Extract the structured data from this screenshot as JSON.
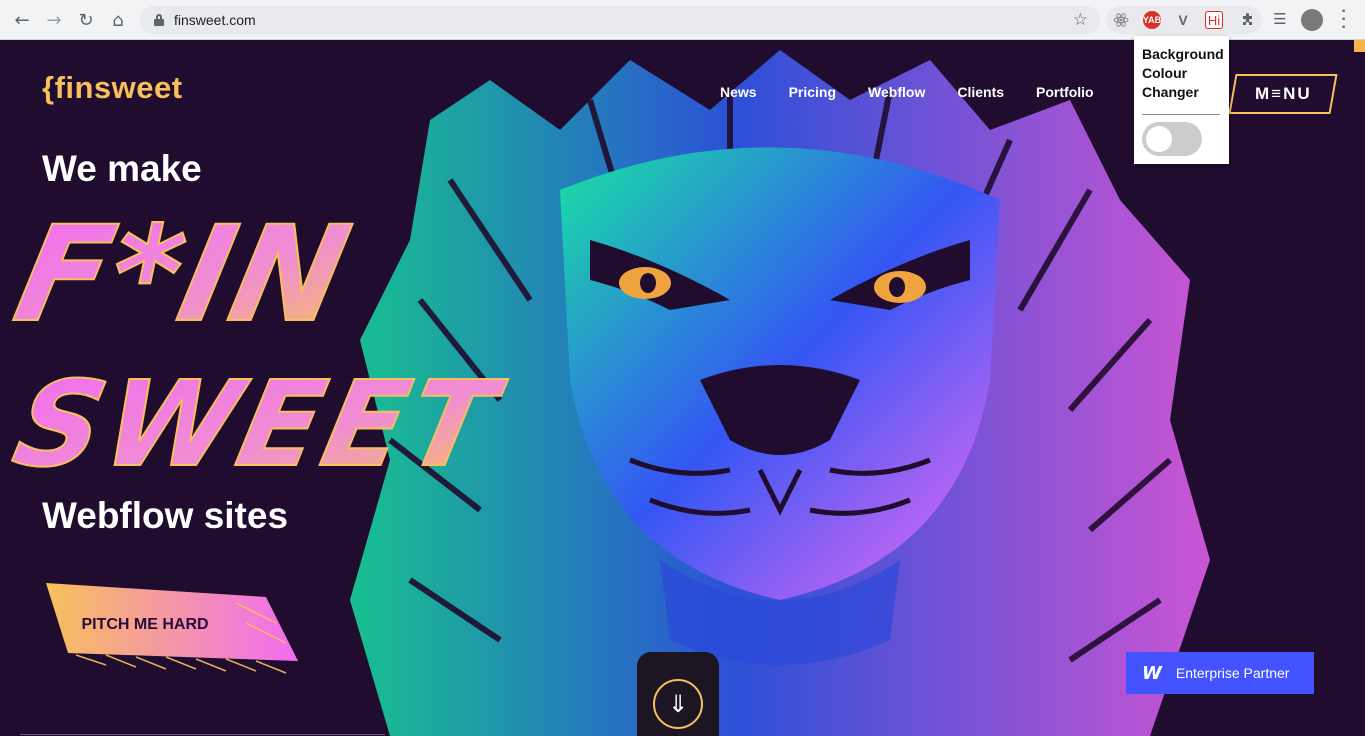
{
  "browser": {
    "url": "finsweet.com",
    "nav_icons": [
      "back-arrow-icon",
      "forward-arrow-icon",
      "reload-icon",
      "home-icon"
    ],
    "extensions": [
      {
        "name": "react-devtools-extension-icon",
        "label": ""
      },
      {
        "name": "yab-extension-icon",
        "label": "YAB"
      },
      {
        "name": "vue-extension-icon",
        "label": "V"
      },
      {
        "name": "hi-extension-icon",
        "label": "Hi"
      }
    ]
  },
  "extension_popup": {
    "title": "Background Colour Changer",
    "toggle_on": false
  },
  "site": {
    "logo": "{finsweet",
    "nav": [
      "News",
      "Pricing",
      "Webflow",
      "Clients",
      "Portfolio"
    ],
    "menu_label": "M≡NU",
    "hero_top": "We make",
    "hero_brush_line1": "F*IN",
    "hero_brush_line2": "SWEET",
    "hero_bottom": "Webflow sites",
    "cta": "PITCH ME HARD",
    "partner_logo": "W",
    "partner": "Enterprise Partner"
  },
  "colors": {
    "background": "#200c2e",
    "accent_yellow": "#f7c05c",
    "accent_pink": "#f16cf2",
    "lion_green": "#17e3a0",
    "lion_blue": "#2f5cf5",
    "partner_blue": "#4353ff"
  }
}
